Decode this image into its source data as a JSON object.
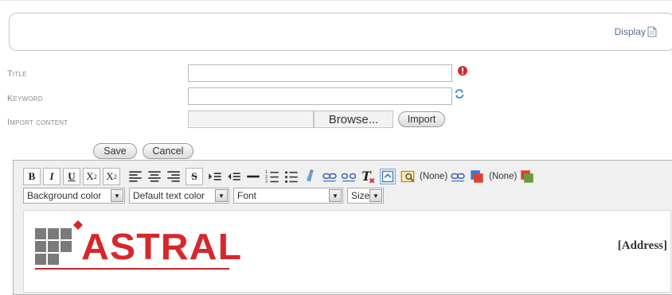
{
  "header": {
    "display_label": "Display"
  },
  "form": {
    "title_label": "Title",
    "keyword_label": "Keyword",
    "import_label": "Import content",
    "title_value": "",
    "keyword_value": "",
    "browse_label": "Browse...",
    "import_button": "Import",
    "save_button": "Save",
    "cancel_button": "Cancel"
  },
  "toolbar": {
    "bold": "B",
    "italic": "I",
    "underline": "U",
    "subscript": "X",
    "superscript": "X",
    "strike": "S",
    "style_none_1": "(None)",
    "style_none_2": "(None)"
  },
  "dropdowns": {
    "background_color": "Background color",
    "text_color": "Default text color",
    "font": "Font",
    "size": "Size"
  },
  "content": {
    "logo_text": "ASTRAL",
    "address": "[Address]"
  },
  "colors": {
    "accent_red": "#d6282b",
    "link_blue": "#5a6e86"
  }
}
